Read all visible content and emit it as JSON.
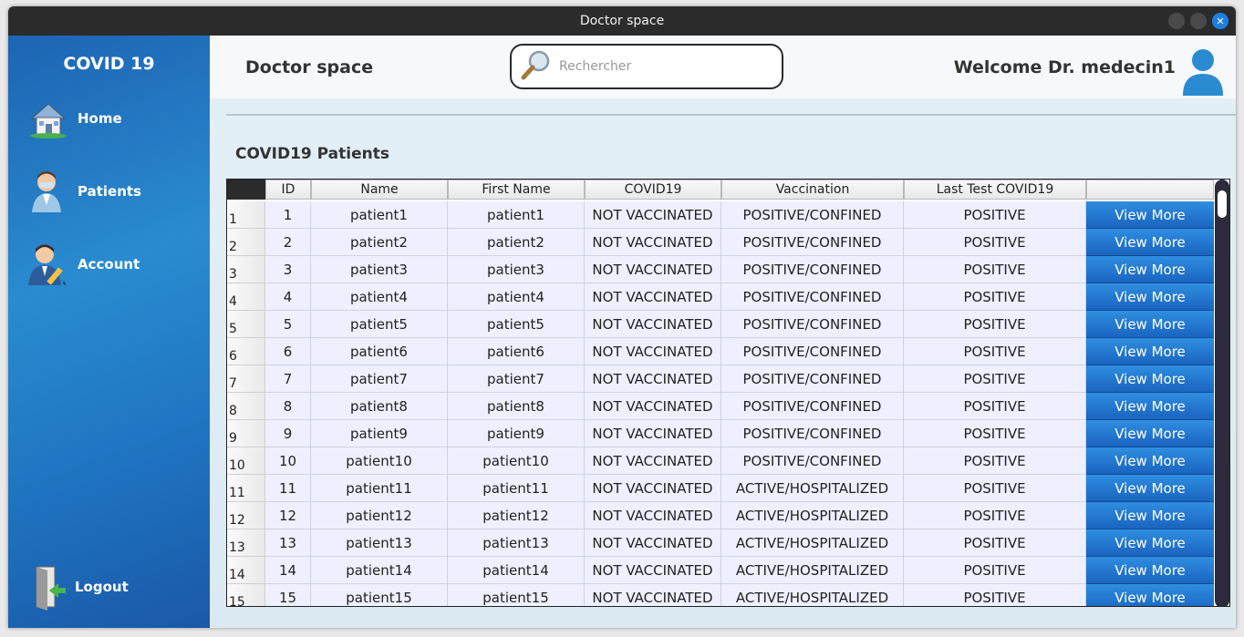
{
  "window": {
    "title": "Doctor space"
  },
  "sidebar": {
    "brand": "COVID 19",
    "items": [
      {
        "label": "Home",
        "icon": "home-icon"
      },
      {
        "label": "Patients",
        "icon": "patient-icon"
      },
      {
        "label": "Account",
        "icon": "account-edit-icon"
      }
    ],
    "logout": {
      "label": "Logout",
      "icon": "logout-door-icon"
    }
  },
  "header": {
    "title": "Doctor space",
    "search_placeholder": "Rechercher",
    "welcome": "Welcome Dr. medecin1"
  },
  "section": {
    "title": "COVID19 Patients"
  },
  "table": {
    "columns": [
      "ID",
      "Name",
      "First Name",
      "COVID19",
      "Vaccination",
      "Last Test COVID19",
      ""
    ],
    "button_label": "View More",
    "rows": [
      {
        "n": "1",
        "id": "1",
        "name": "patient1",
        "first": "patient1",
        "covid": "NOT VACCINATED",
        "vacc": "POSITIVE/CONFINED",
        "test": "POSITIVE"
      },
      {
        "n": "2",
        "id": "2",
        "name": "patient2",
        "first": "patient2",
        "covid": "NOT VACCINATED",
        "vacc": "POSITIVE/CONFINED",
        "test": "POSITIVE"
      },
      {
        "n": "3",
        "id": "3",
        "name": "patient3",
        "first": "patient3",
        "covid": "NOT VACCINATED",
        "vacc": "POSITIVE/CONFINED",
        "test": "POSITIVE"
      },
      {
        "n": "4",
        "id": "4",
        "name": "patient4",
        "first": "patient4",
        "covid": "NOT VACCINATED",
        "vacc": "POSITIVE/CONFINED",
        "test": "POSITIVE"
      },
      {
        "n": "5",
        "id": "5",
        "name": "patient5",
        "first": "patient5",
        "covid": "NOT VACCINATED",
        "vacc": "POSITIVE/CONFINED",
        "test": "POSITIVE"
      },
      {
        "n": "6",
        "id": "6",
        "name": "patient6",
        "first": "patient6",
        "covid": "NOT VACCINATED",
        "vacc": "POSITIVE/CONFINED",
        "test": "POSITIVE"
      },
      {
        "n": "7",
        "id": "7",
        "name": "patient7",
        "first": "patient7",
        "covid": "NOT VACCINATED",
        "vacc": "POSITIVE/CONFINED",
        "test": "POSITIVE"
      },
      {
        "n": "8",
        "id": "8",
        "name": "patient8",
        "first": "patient8",
        "covid": "NOT VACCINATED",
        "vacc": "POSITIVE/CONFINED",
        "test": "POSITIVE"
      },
      {
        "n": "9",
        "id": "9",
        "name": "patient9",
        "first": "patient9",
        "covid": "NOT VACCINATED",
        "vacc": "POSITIVE/CONFINED",
        "test": "POSITIVE"
      },
      {
        "n": "10",
        "id": "10",
        "name": "patient10",
        "first": "patient10",
        "covid": "NOT VACCINATED",
        "vacc": "POSITIVE/CONFINED",
        "test": "POSITIVE"
      },
      {
        "n": "11",
        "id": "11",
        "name": "patient11",
        "first": "patient11",
        "covid": "NOT VACCINATED",
        "vacc": "ACTIVE/HOSPITALIZED",
        "test": "POSITIVE"
      },
      {
        "n": "12",
        "id": "12",
        "name": "patient12",
        "first": "patient12",
        "covid": "NOT VACCINATED",
        "vacc": "ACTIVE/HOSPITALIZED",
        "test": "POSITIVE"
      },
      {
        "n": "13",
        "id": "13",
        "name": "patient13",
        "first": "patient13",
        "covid": "NOT VACCINATED",
        "vacc": "ACTIVE/HOSPITALIZED",
        "test": "POSITIVE"
      },
      {
        "n": "14",
        "id": "14",
        "name": "patient14",
        "first": "patient14",
        "covid": "NOT VACCINATED",
        "vacc": "ACTIVE/HOSPITALIZED",
        "test": "POSITIVE"
      },
      {
        "n": "15",
        "id": "15",
        "name": "patient15",
        "first": "patient15",
        "covid": "NOT VACCINATED",
        "vacc": "ACTIVE/HOSPITALIZED",
        "test": "POSITIVE"
      }
    ]
  }
}
